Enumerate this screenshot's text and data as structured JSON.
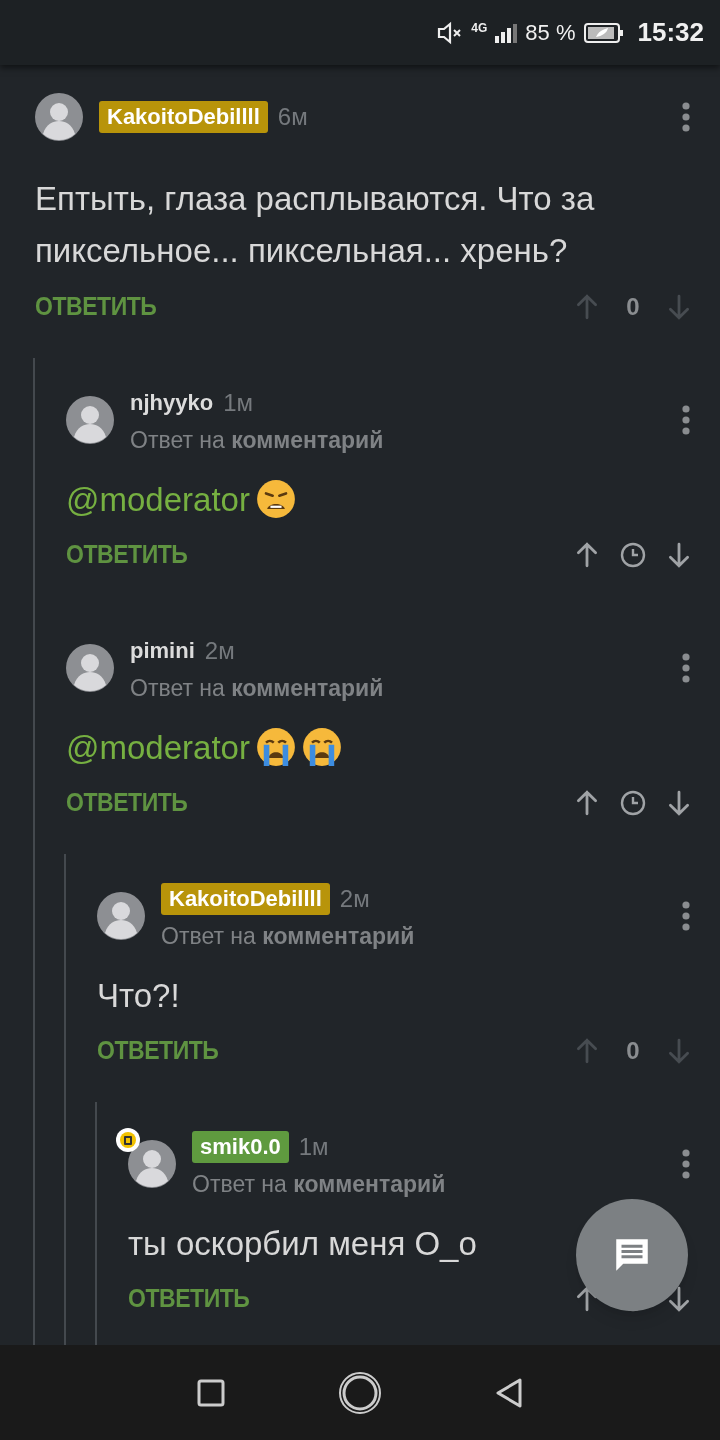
{
  "status_bar": {
    "network": "4G",
    "battery": "85 %",
    "time": "15:32"
  },
  "comments": [
    {
      "author": "KakoitoDebillll",
      "color": "#b8940a",
      "time": "6м",
      "body": [
        {
          "kind": "text",
          "text": "Ептыть, глаза расплываются. Что за пиксельное... пиксельная... хрень?"
        }
      ],
      "reply_label": "ОТВЕТИТЬ",
      "score": "0",
      "children": [
        {
          "author": "njhyyko",
          "time": "1м",
          "reply_to": "Ответ на **комментарий**",
          "body": [
            {
              "kind": "mention",
              "text": "@moderator"
            },
            {
              "kind": "weary"
            }
          ],
          "reply_label": "ОТВЕТИТЬ"
        },
        {
          "author": "pimini",
          "time": "2м",
          "reply_to": "Ответ на **комментарий**",
          "body": [
            {
              "kind": "mention",
              "text": "@moderator"
            },
            {
              "kind": "crying"
            },
            {
              "kind": "crying"
            }
          ],
          "reply_label": "ОТВЕТИТЬ",
          "children": [
            {
              "author": "KakoitoDebillll",
              "color": "#b8940a",
              "time": "2м",
              "reply_to": "Ответ на **комментарий**",
              "body": [
                {
                  "kind": "text",
                  "text": "Что?!"
                }
              ],
              "reply_label": "ОТВЕТИТЬ",
              "score": "0",
              "children": [
                {
                  "author": "smik0.0",
                  "color": "#5f9a3f",
                  "avatar_badge": true,
                  "time": "1м",
                  "reply_to": "Ответ на **комментарий**",
                  "body": [
                    {
                      "kind": "text",
                      "text": "ты оскорбил меня О_о"
                    }
                  ],
                  "reply_label": "ОТВЕТИТЬ"
                }
              ]
            }
          ]
        }
      ]
    }
  ]
}
